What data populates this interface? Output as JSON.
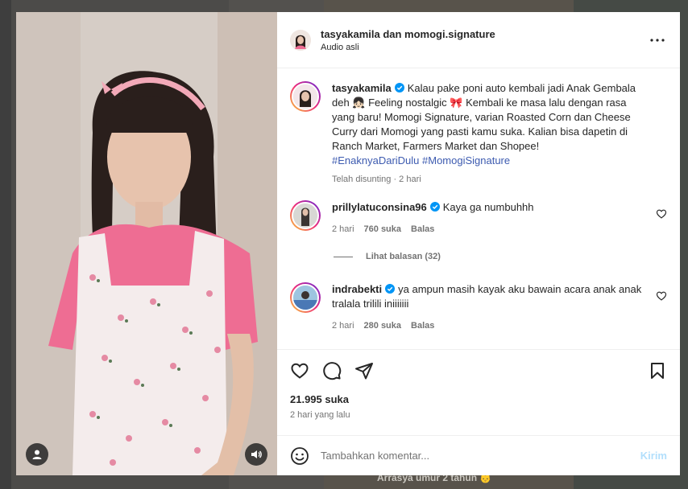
{
  "background": {
    "caption": "Arrasya umur 2 tahun 👶"
  },
  "post": {
    "header": {
      "title": "tasyakamila dan momogi.signature",
      "subtitle": "Audio asli"
    },
    "caption": {
      "username": "tasyakamila",
      "text": "Kalau pake poni auto kembali jadi Anak Gembala deh 👧🏻 Feeling nostalgic 🎀 Kembali ke masa lalu dengan rasa yang baru! Momogi Signature, varian Roasted Corn dan Cheese Curry dari Momogi yang pasti kamu suka. Kalian bisa dapetin di Ranch Market, Farmers Market dan Shopee!",
      "hashtags": "#EnaknyaDariDulu #MomogiSignature",
      "meta": "Telah disunting · 2 hari"
    },
    "comments": [
      {
        "username": "prillylatuconsina96",
        "text": "Kaya ga numbuhhh",
        "time": "2 hari",
        "likes": "760 suka",
        "reply": "Balas",
        "view_replies": "Lihat balasan (32)"
      },
      {
        "username": "indrabekti",
        "text": "ya ampun masih kayak aku bawain acara anak anak tralala trilili iniiiiiii",
        "time": "2 hari",
        "likes": "280 suka",
        "reply": "Balas"
      }
    ],
    "likes": "21.995 suka",
    "date": "2 hari yang lalu",
    "add_comment": {
      "placeholder": "Tambahkan komentar...",
      "post_label": "Kirim"
    }
  },
  "colors": {
    "link": "#3d5bb0",
    "verified": "#0095f6",
    "post_button_disabled": "#b2dffc",
    "story_ring": [
      "#f9ce34",
      "#ee2a7b",
      "#6228d7"
    ]
  }
}
